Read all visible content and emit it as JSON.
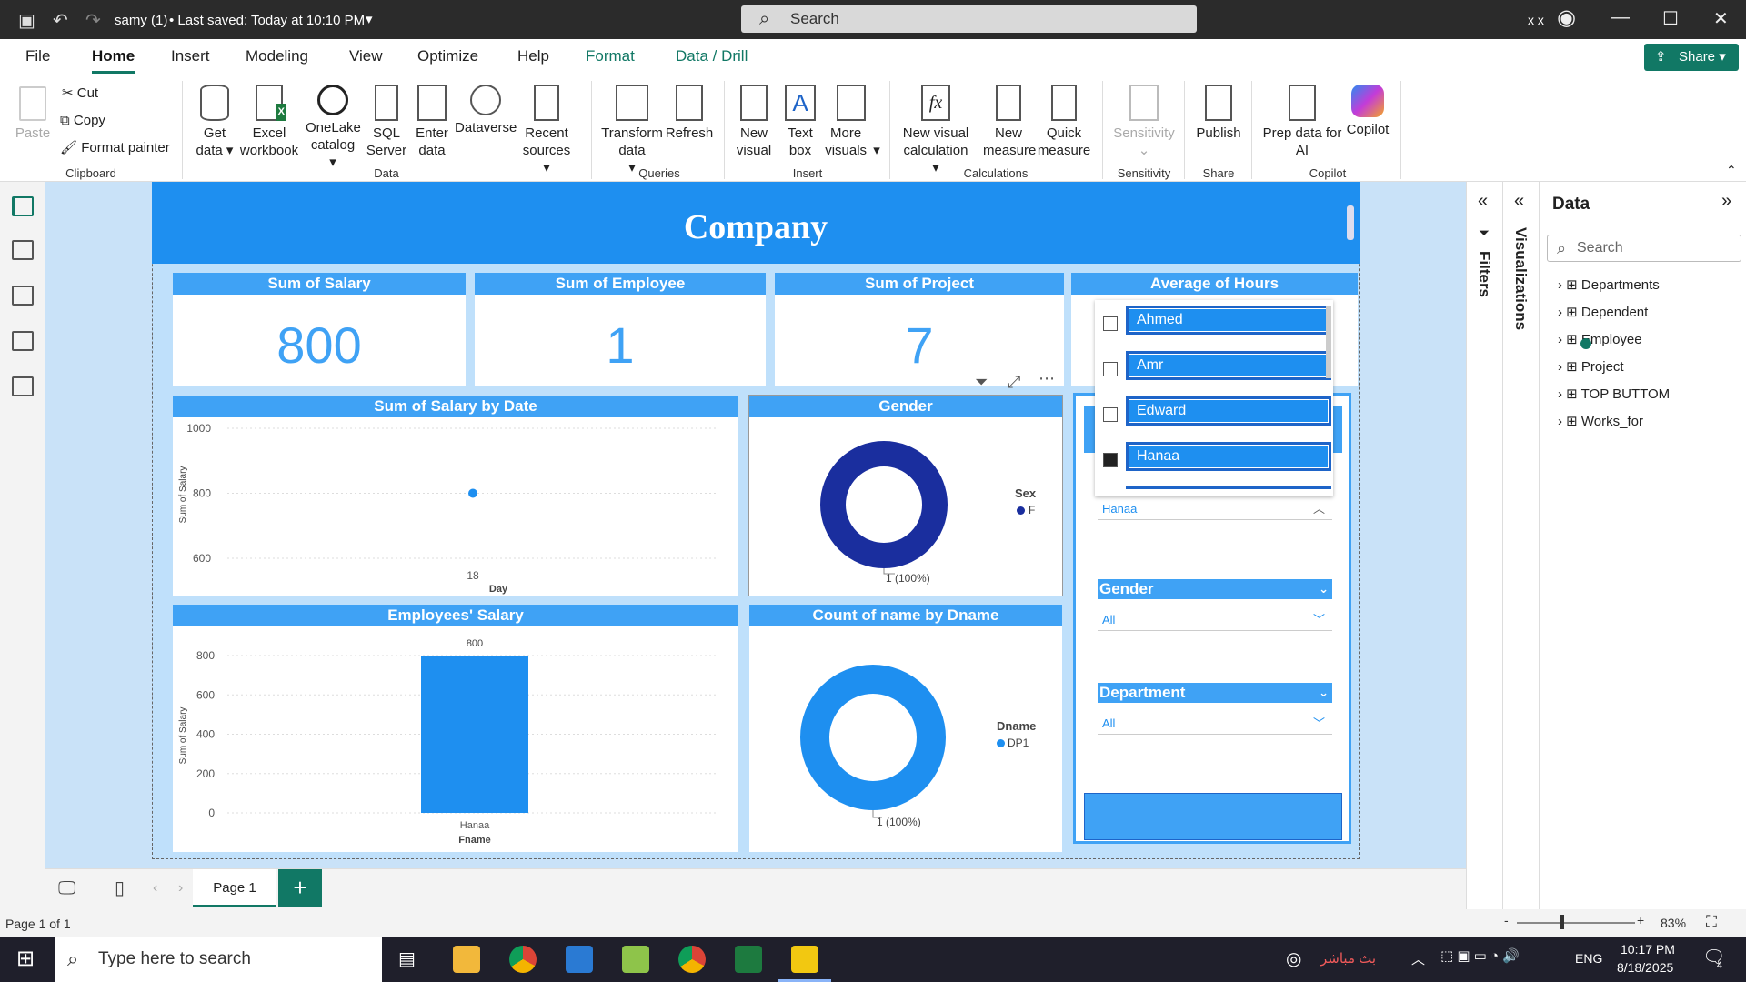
{
  "titlebar": {
    "file": "samy (1)",
    "saved": "• Last saved: Today at 10:10 PM",
    "search": "Search",
    "user": "x x"
  },
  "tabs": [
    "File",
    "Home",
    "Insert",
    "Modeling",
    "View",
    "Optimize",
    "Help",
    "Format",
    "Data / Drill"
  ],
  "share": "Share",
  "ribbon": {
    "paste": "Paste",
    "cut": "Cut",
    "copy": "Copy",
    "format_painter": "Format painter",
    "get_data": "Get data",
    "excel": "Excel workbook",
    "onelake": "OneLake catalog",
    "sql": "SQL Server",
    "enter": "Enter data",
    "dataverse": "Dataverse",
    "recent": "Recent sources",
    "transform": "Transform data",
    "refresh": "Refresh",
    "new_visual": "New visual",
    "text_box": "Text box",
    "more_visuals": "More visuals",
    "new_visual_calc": "New visual calculation",
    "new_measure": "New measure",
    "quick_measure": "Quick measure",
    "sensitivity": "Sensitivity",
    "publish": "Publish",
    "prep": "Prep data for AI",
    "copilot": "Copilot",
    "groups": {
      "clipboard": "Clipboard",
      "data": "Data",
      "queries": "Queries",
      "insert": "Insert",
      "calculations": "Calculations",
      "sensitivity": "Sensitivity",
      "share": "Share",
      "copilot": "Copilot"
    }
  },
  "report": {
    "title": "Company",
    "kpis": [
      {
        "title": "Sum of Salary",
        "value": "800"
      },
      {
        "title": "Sum of Employee",
        "value": "1"
      },
      {
        "title": "Sum of Project",
        "value": "7"
      }
    ],
    "avg_hours_title": "Average of Hours",
    "slicer_names": [
      "Ahmed",
      "Amr",
      "Edward",
      "Hanaa"
    ],
    "slicer_selected": "Hanaa",
    "gender_slicer": {
      "title": "Gender",
      "value": "All"
    },
    "dept_slicer": {
      "title": "Department",
      "value": "All"
    },
    "salary_by_date": {
      "title": "Sum of Salary by Date",
      "ylabel": "Sum of Salary",
      "xlabel": "Day",
      "yticks": [
        "1000",
        "800",
        "600"
      ],
      "xtick": "18"
    },
    "gender": {
      "title": "Gender",
      "legend_title": "Sex",
      "legend_item": "F",
      "label": "1 (100%)"
    },
    "emp_salary": {
      "title": "Employees' Salary",
      "ylabel": "Sum of Salary",
      "xlabel": "Fname",
      "yticks": [
        "800",
        "600",
        "400",
        "200",
        "0"
      ],
      "category": "Hanaa",
      "data_label": "800"
    },
    "count_by_dname": {
      "title": "Count of name by Dname",
      "legend_title": "Dname",
      "legend_item": "DP1",
      "label": "1 (100%)"
    }
  },
  "chart_data": [
    {
      "type": "scatter",
      "title": "Sum of Salary by Date",
      "xlabel": "Day",
      "ylabel": "Sum of Salary",
      "x": [
        18
      ],
      "y": [
        800
      ],
      "ylim": [
        600,
        1000
      ]
    },
    {
      "type": "pie",
      "title": "Gender",
      "categories": [
        "F"
      ],
      "values": [
        1
      ],
      "colors": [
        "#1a2e9e"
      ]
    },
    {
      "type": "bar",
      "title": "Employees' Salary",
      "xlabel": "Fname",
      "ylabel": "Sum of Salary",
      "categories": [
        "Hanaa"
      ],
      "values": [
        800
      ],
      "ylim": [
        0,
        800
      ]
    },
    {
      "type": "pie",
      "title": "Count of name by Dname",
      "categories": [
        "DP1"
      ],
      "values": [
        1
      ],
      "colors": [
        "#1e8ff0"
      ]
    }
  ],
  "panes": {
    "filters": "Filters",
    "visualizations": "Visualizations",
    "data": "Data",
    "data_search": "Search",
    "tables": [
      "Departments",
      "Dependent",
      "Employee",
      "Project",
      "TOP BUTTOM",
      "Works_for"
    ]
  },
  "pages": {
    "current": "Page 1",
    "status": "Page 1 of 1",
    "zoom": "83%"
  },
  "taskbar": {
    "search": "Type here to search",
    "live": "بث مباشر",
    "lang": "ENG",
    "time": "10:17 PM",
    "date": "8/18/2025",
    "notif": "4"
  },
  "colors": {
    "accent": "#117865",
    "header": "#1e8ff0",
    "title_band": "#3fa2f5",
    "dark_blue": "#1a2e9e"
  }
}
